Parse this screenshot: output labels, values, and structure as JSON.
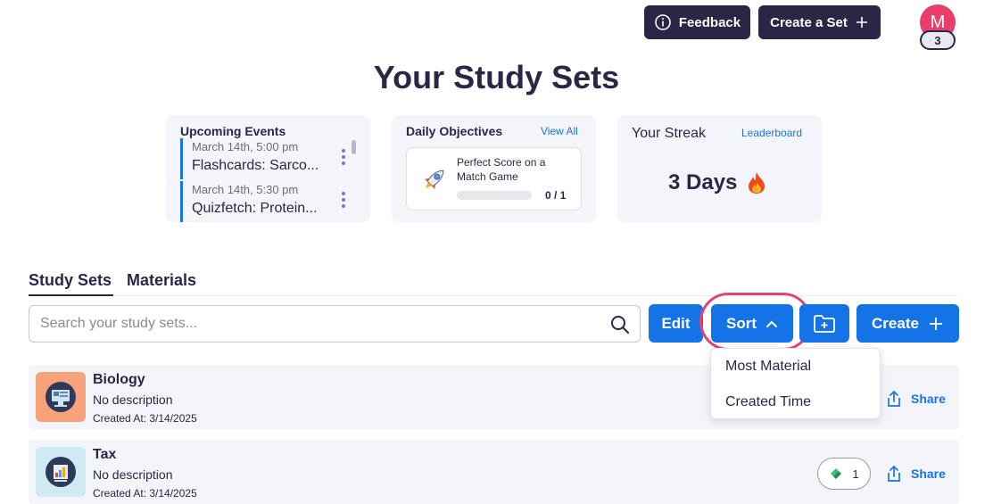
{
  "header": {
    "feedback_label": "Feedback",
    "create_set_label": "Create a Set",
    "avatar_initial": "M",
    "avatar_badge": "3"
  },
  "page_title": "Your Study Sets",
  "upcoming": {
    "title": "Upcoming Events",
    "events": [
      {
        "time": "March 14th, 5:00 pm",
        "title": "Flashcards: Sarco..."
      },
      {
        "time": "March 14th, 5:30 pm",
        "title": "Quizfetch: Protein..."
      }
    ]
  },
  "objectives": {
    "title": "Daily Objectives",
    "view_all": "View All",
    "item": {
      "icon": "rocket-icon",
      "title": "Perfect Score on a Match Game",
      "progress": "0 / 1",
      "progress_fraction": 0
    }
  },
  "streak": {
    "title": "Your Streak",
    "leaderboard": "Leaderboard",
    "value": "3 Days",
    "icon": "fire-icon"
  },
  "tabs": [
    {
      "label": "Study Sets",
      "active": true
    },
    {
      "label": "Materials",
      "active": false
    }
  ],
  "search": {
    "placeholder": "Search your study sets...",
    "value": ""
  },
  "toolbar": {
    "edit_label": "Edit",
    "sort_label": "Sort",
    "create_label": "Create"
  },
  "sort_menu": [
    "Most Material",
    "Created Time"
  ],
  "sets": [
    {
      "title": "Biology",
      "description": "No description",
      "created": "Created At: 3/14/2025",
      "share_label": "Share",
      "material_count": null
    },
    {
      "title": "Tax",
      "description": "No description",
      "created": "Created At: 3/14/2025",
      "share_label": "Share",
      "material_count": "1"
    }
  ],
  "colors": {
    "primary_blue": "#1473e6",
    "dark_navy": "#2a2746",
    "avatar_pink": "#ea3e6a",
    "highlight_ring": "#e0427a",
    "card_bg": "#f4f5fb"
  }
}
